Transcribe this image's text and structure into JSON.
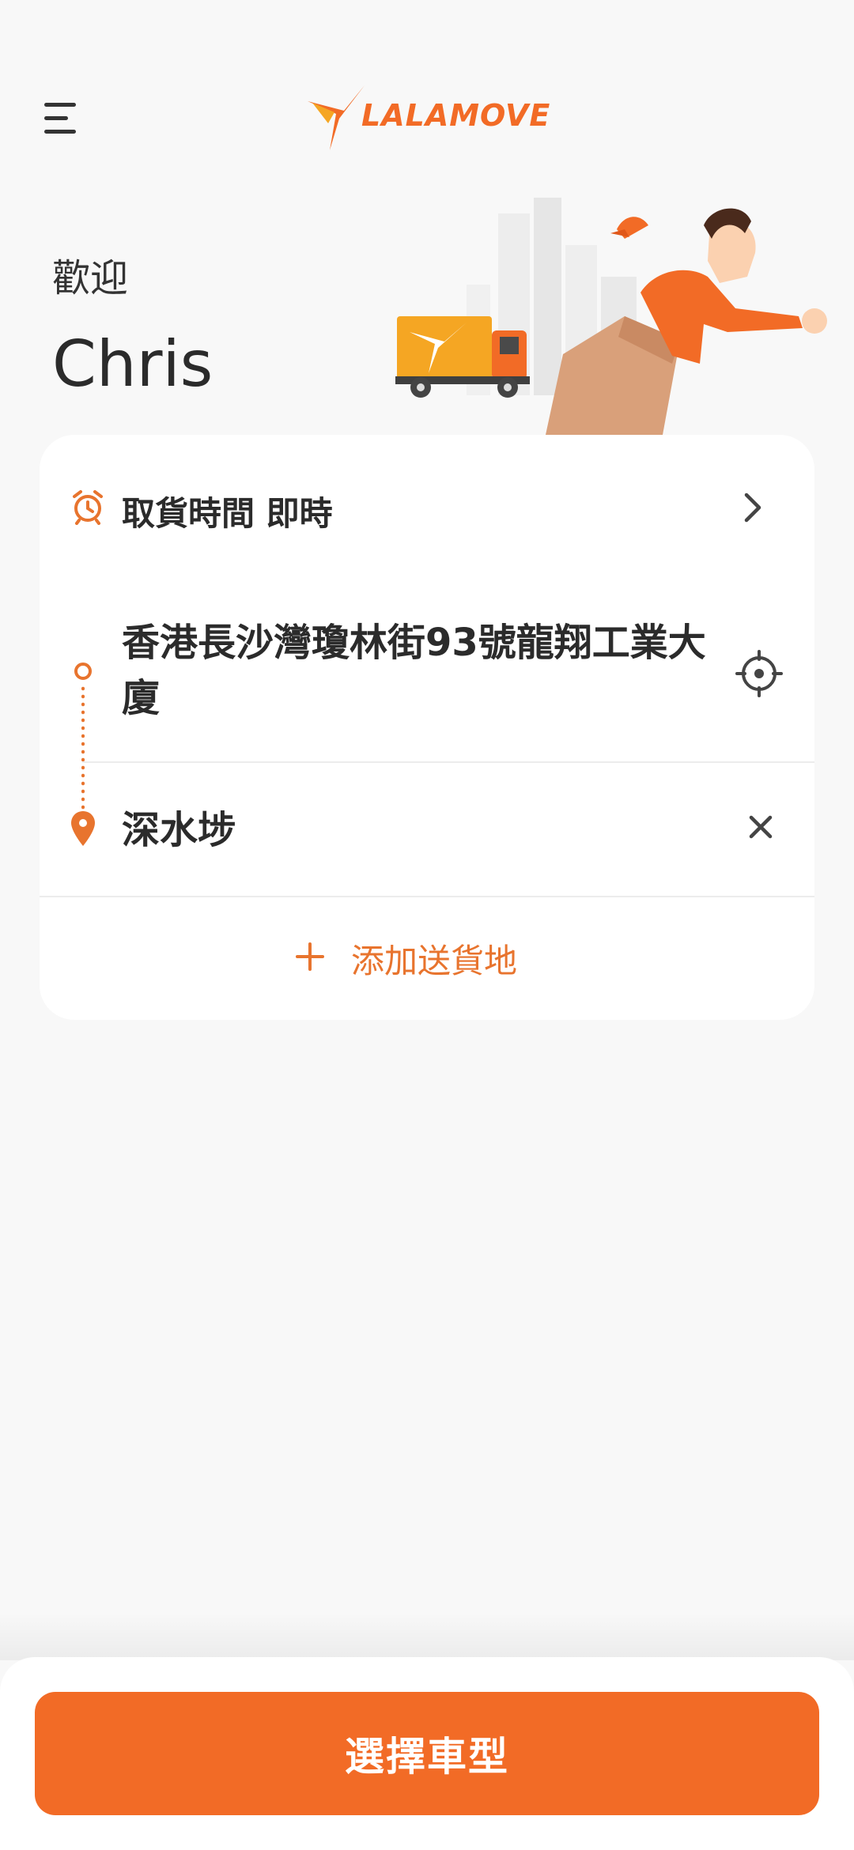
{
  "header": {
    "brand": "LALAMOVE",
    "menu_icon": "menu-icon",
    "logo_icon": "bird-logo-icon"
  },
  "greeting": {
    "welcome": "歡迎",
    "name": "Chris"
  },
  "order": {
    "pickup_time_label": "取貨時間 即時",
    "pickup_address": "香港長沙灣瓊林街93號龍翔工業大廈",
    "dropoff_address": "深水埗",
    "add_stop_label": "添加送貨地"
  },
  "actions": {
    "select_vehicle_label": "選擇車型"
  },
  "colors": {
    "brand_orange": "#f26b26",
    "accent_orange": "#e8742e",
    "text_dark": "#2b2b2b",
    "background": "#f8f8f8"
  }
}
